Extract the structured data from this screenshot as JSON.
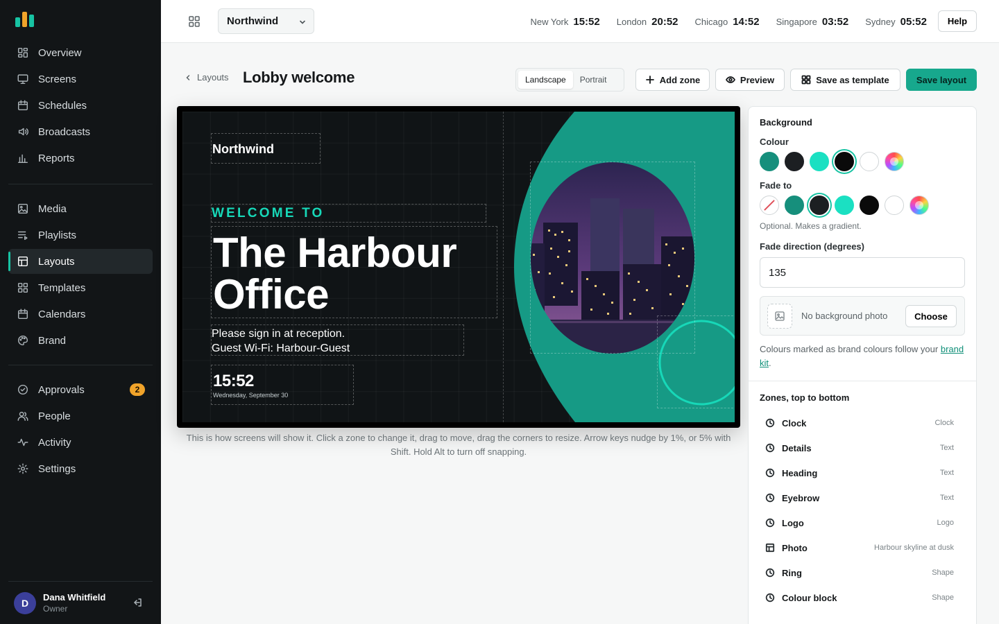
{
  "sidebar": {
    "colors": {
      "bg": "#121517",
      "accent": "#17c3a3"
    },
    "groups": [
      [
        {
          "label": "Overview",
          "icon": "overview-icon"
        },
        {
          "label": "Screens",
          "icon": "monitor-icon"
        },
        {
          "label": "Schedules",
          "icon": "calendar-icon"
        },
        {
          "label": "Broadcasts",
          "icon": "speaker-icon"
        },
        {
          "label": "Reports",
          "icon": "bar-chart-icon"
        }
      ],
      [
        {
          "label": "Media",
          "icon": "image-icon"
        },
        {
          "label": "Playlists",
          "icon": "playlist-icon"
        },
        {
          "label": "Layouts",
          "icon": "layout-icon",
          "active": true
        },
        {
          "label": "Templates",
          "icon": "templates-icon"
        },
        {
          "label": "Calendars",
          "icon": "calendar-icon"
        },
        {
          "label": "Brand",
          "icon": "palette-icon"
        }
      ],
      [
        {
          "label": "Approvals",
          "icon": "check-circle-icon",
          "badge": "2"
        },
        {
          "label": "People",
          "icon": "people-icon"
        },
        {
          "label": "Activity",
          "icon": "activity-icon"
        },
        {
          "label": "Settings",
          "icon": "gear-icon"
        }
      ]
    ],
    "user": {
      "initial": "D",
      "name": "Dana Whitfield",
      "role": "Owner"
    }
  },
  "topbar": {
    "org": "Northwind",
    "clocks": [
      {
        "city": "New York",
        "time": "15:52"
      },
      {
        "city": "London",
        "time": "20:52"
      },
      {
        "city": "Chicago",
        "time": "14:52"
      },
      {
        "city": "Singapore",
        "time": "03:52"
      },
      {
        "city": "Sydney",
        "time": "05:52"
      }
    ],
    "help": "Help"
  },
  "header": {
    "breadcrumb": "Layouts",
    "title": "Lobby welcome",
    "orientation": {
      "landscape": "Landscape",
      "portrait": "Portrait",
      "selected": "Landscape"
    },
    "add_zone": "Add zone",
    "preview": "Preview",
    "save_template": "Save as template",
    "save_layout": "Save layout"
  },
  "canvas": {
    "logo": "Northwind",
    "eyebrow": "WELCOME TO",
    "heading_line1": "The Harbour",
    "heading_line2": "Office",
    "details_line1": "Please sign in at reception.",
    "details_line2": "Guest Wi-Fi: Harbour-Guest",
    "clock_time": "15:52",
    "clock_date": "Wednesday, September 30",
    "colors": {
      "bg": "#101416",
      "teal": "#169a85",
      "eyebrow": "#17d8b8",
      "ring": "#17d8b8"
    }
  },
  "caption": "This is how screens will show it. Click a zone to change it, drag to move, drag the corners to resize. Arrow keys nudge by 1%, or 5% with Shift. Hold Alt to turn off snapping.",
  "panel": {
    "background_title": "Background",
    "colour_label": "Colour",
    "colour_swatches": [
      "#168f7c",
      "#1c1f22",
      "#1be0c2",
      "#0a0a0a",
      "#ffffff",
      "custom"
    ],
    "colour_selected": 3,
    "fade_label": "Fade to",
    "fade_swatches": [
      "none",
      "#168f7c",
      "#1c1f22",
      "#1be0c2",
      "#0a0a0a",
      "#ffffff",
      "custom"
    ],
    "fade_selected": 2,
    "fade_hint": "Optional. Makes a gradient.",
    "direction_label": "Fade direction (degrees)",
    "direction_value": "135",
    "photo_text": "No background photo",
    "choose": "Choose",
    "brand_note": "Colours marked as brand colours follow your",
    "brand_link": "brand kit",
    "zones_title": "Zones, top to bottom",
    "zones": [
      {
        "name": "Clock",
        "type": "Clock",
        "icon": "clock-icon"
      },
      {
        "name": "Details",
        "type": "Text",
        "icon": "clock-icon"
      },
      {
        "name": "Heading",
        "type": "Text",
        "icon": "clock-icon"
      },
      {
        "name": "Eyebrow",
        "type": "Text",
        "icon": "clock-icon"
      },
      {
        "name": "Logo",
        "type": "Logo",
        "icon": "clock-icon"
      },
      {
        "name": "Photo",
        "type": "Harbour skyline at dusk",
        "icon": "layout-icon"
      },
      {
        "name": "Ring",
        "type": "Shape",
        "icon": "clock-icon"
      },
      {
        "name": "Colour block",
        "type": "Shape",
        "icon": "clock-icon"
      }
    ]
  }
}
